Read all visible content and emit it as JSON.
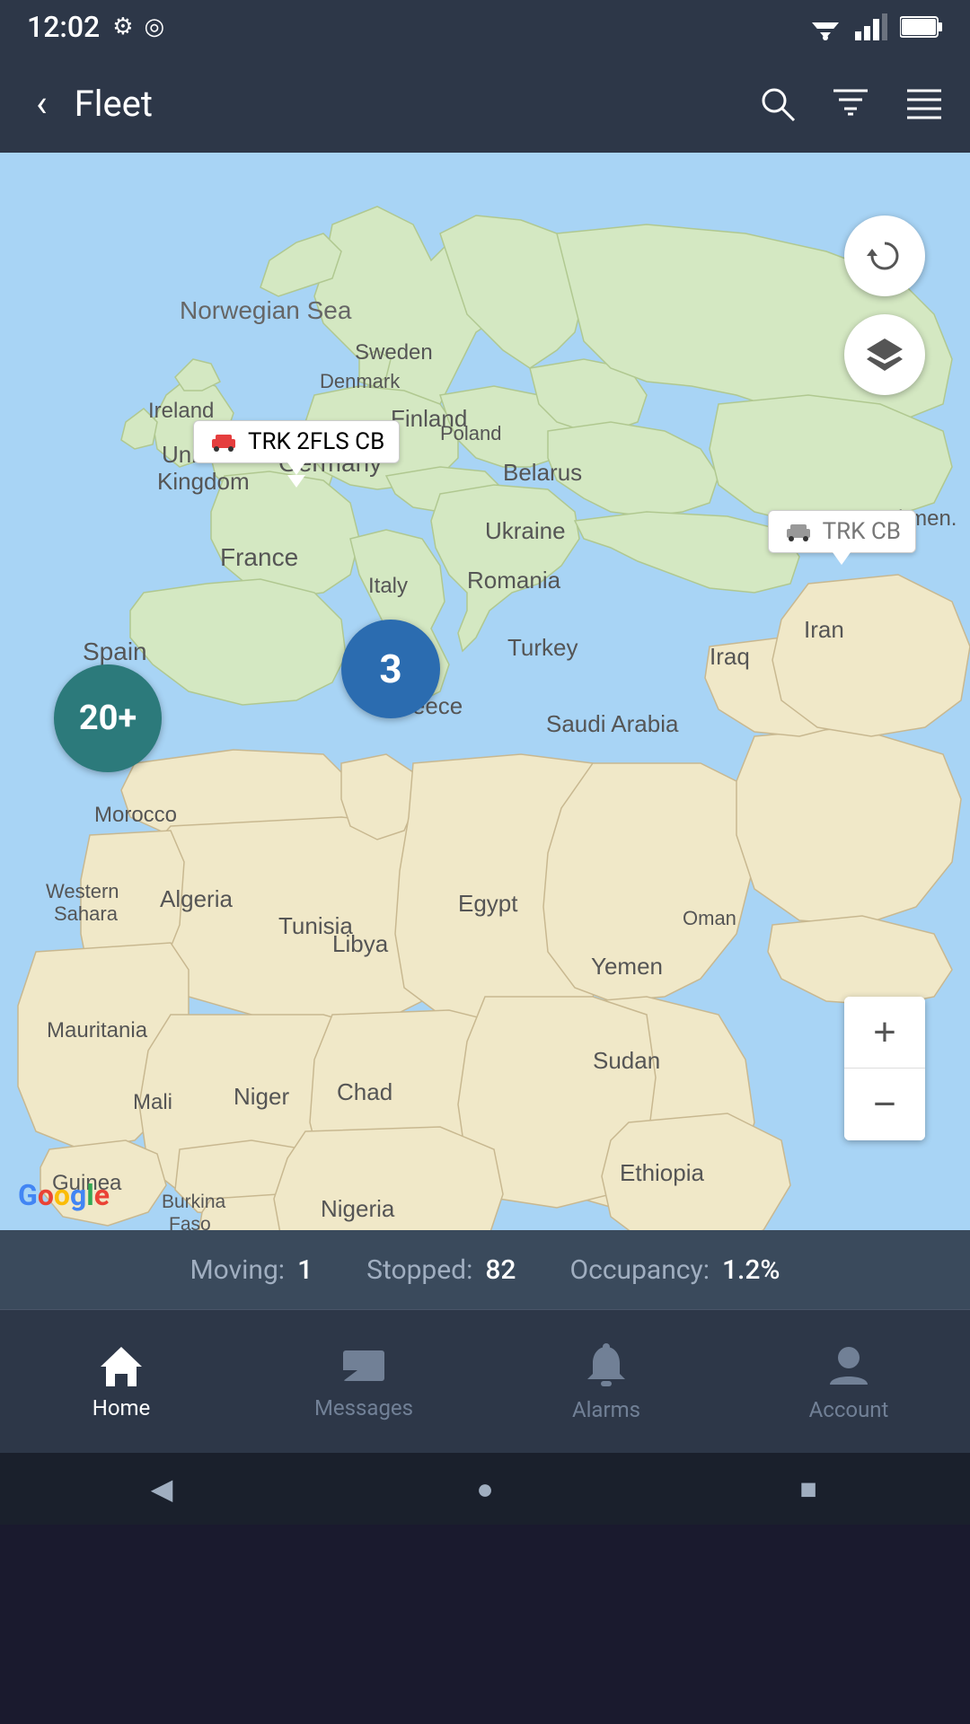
{
  "status_bar": {
    "time": "12:02",
    "icons": [
      "⚙",
      "◎"
    ]
  },
  "app_bar": {
    "back_icon": "‹",
    "title": "Fleet",
    "search_icon": "search",
    "filter_icon": "filter",
    "menu_icon": "menu"
  },
  "map": {
    "refresh_icon": "↻",
    "layers_icon": "◆",
    "zoom_in": "+",
    "zoom_out": "−",
    "markers": [
      {
        "id": "trk2flscb",
        "label": "TRK 2FLS CB",
        "type": "active"
      },
      {
        "id": "trkcb",
        "label": "TRK CB",
        "type": "inactive"
      }
    ],
    "clusters": [
      {
        "id": "cluster20",
        "count": "20+",
        "color": "#2c7a7b"
      },
      {
        "id": "cluster3",
        "count": "3",
        "color": "#2b6cb0"
      }
    ],
    "google_logo": "Google"
  },
  "stats_bar": {
    "moving_label": "Moving:",
    "moving_value": "1",
    "stopped_label": "Stopped:",
    "stopped_value": "82",
    "occupancy_label": "Occupancy:",
    "occupancy_value": "1.2%"
  },
  "bottom_nav": {
    "items": [
      {
        "id": "home",
        "label": "Home",
        "icon": "🏠",
        "active": true
      },
      {
        "id": "messages",
        "label": "Messages",
        "icon": "✉",
        "active": false
      },
      {
        "id": "alarms",
        "label": "Alarms",
        "icon": "🔔",
        "active": false
      },
      {
        "id": "account",
        "label": "Account",
        "icon": "👤",
        "active": false
      }
    ]
  },
  "android_nav": {
    "back": "◀",
    "home": "●",
    "recent": "■"
  }
}
